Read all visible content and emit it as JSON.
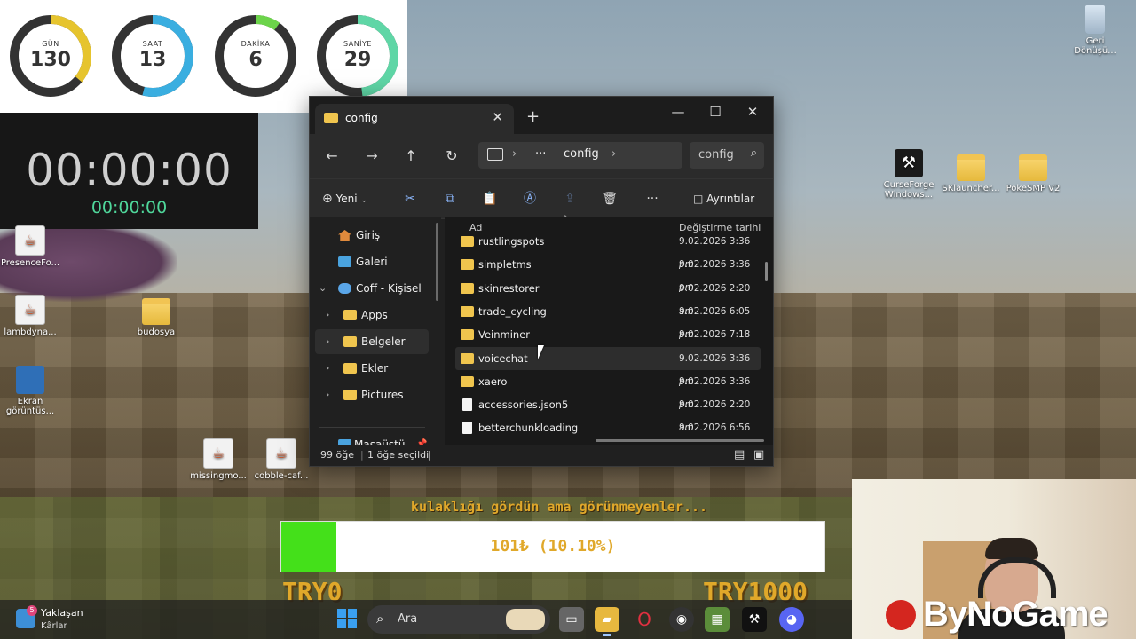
{
  "countdown": {
    "gauges": [
      {
        "label": "GÜN",
        "value": "130",
        "color": "#e6c42e",
        "fraction": 0.36
      },
      {
        "label": "SAAT",
        "value": "13",
        "color": "#3aaee0",
        "fraction": 0.54
      },
      {
        "label": "DAKİKA",
        "value": "6",
        "color": "#6cd44a",
        "fraction": 0.1
      },
      {
        "label": "SANİYE",
        "value": "29",
        "color": "#5fd6a6",
        "fraction": 0.48
      }
    ]
  },
  "stopwatch": {
    "main": "00:00:00",
    "sub": "00:00:00"
  },
  "desktop": {
    "icons": {
      "recycle": "Geri\nDönüşü...",
      "curseforge": "CurseForge\nWindows...",
      "sklauncher": "SKlauncher...",
      "pokesmp": "PokeSMP V2",
      "presence": "PresenceFo...",
      "lambdyna": "lambdyna...",
      "budosya": "budosya",
      "ekran": "Ekran\ngörüntüs...",
      "missingmo": "missingmo...",
      "cobble": "cobble-caf..."
    }
  },
  "explorer": {
    "tab_title": "config",
    "path_ellipsis": "···",
    "path_current": "config",
    "search_placeholder": "config",
    "new_label": "Yeni",
    "details_label": "Ayrıntılar",
    "sidebar": [
      {
        "label": "Giriş",
        "icon": "home-icon"
      },
      {
        "label": "Galeri",
        "icon": "gallery-icon"
      },
      {
        "label": "Coff - Kişisel",
        "icon": "onedrive-icon"
      },
      {
        "label": "Apps",
        "icon": "folder-icon"
      },
      {
        "label": "Belgeler",
        "icon": "folder-icon"
      },
      {
        "label": "Ekler",
        "icon": "folder-icon"
      },
      {
        "label": "Pictures",
        "icon": "folder-icon"
      },
      {
        "label": "Masaüstü",
        "icon": "desktop-icon"
      }
    ],
    "columns": {
      "name": "Ad",
      "date": "Değiştirme tarihi"
    },
    "files": [
      {
        "name": "rustlingspots",
        "date": "9.02.2026 3:36 ",
        "ampm": "pm",
        "type": "folder"
      },
      {
        "name": "simpletms",
        "date": "9.02.2026 3:36 ",
        "ampm": "pm",
        "type": "folder"
      },
      {
        "name": "skinrestorer",
        "date": "9.02.2026 2:20 ",
        "ampm": "am",
        "type": "folder"
      },
      {
        "name": "trade_cycling",
        "date": "9.02.2026 6:05 ",
        "ampm": "pm",
        "type": "folder"
      },
      {
        "name": "Veinminer",
        "date": "9.02.2026 7:18 ",
        "ampm": "pm",
        "type": "folder"
      },
      {
        "name": "voicechat",
        "date": "9.02.2026 3:36 ",
        "ampm": "pm",
        "type": "folder"
      },
      {
        "name": "xaero",
        "date": "9.02.2026 3:36 ",
        "ampm": "pm",
        "type": "folder"
      },
      {
        "name": "accessories.json5",
        "date": "9.02.2026 2:20 ",
        "ampm": "am",
        "type": "file"
      },
      {
        "name": "betterchunkloading",
        "date": "9.02.2026 6:56 ",
        "ampm": "pm",
        "type": "file"
      }
    ],
    "status": {
      "count": "99 öğe",
      "selected": "1 öğe seçildi"
    }
  },
  "donation": {
    "caption": "kulaklığı gördün ama görünmeyenler...",
    "amount_text": "101₺ (10.10%)",
    "progress": 0.101,
    "min_label": "TRY0",
    "max_label": "TRY1000"
  },
  "taskbar": {
    "weather_title": "Yaklaşan",
    "weather_sub": "Kârlar",
    "weather_badge": "5",
    "search_placeholder": "Ara"
  },
  "webcam": {
    "brand": "ByNoGame"
  }
}
